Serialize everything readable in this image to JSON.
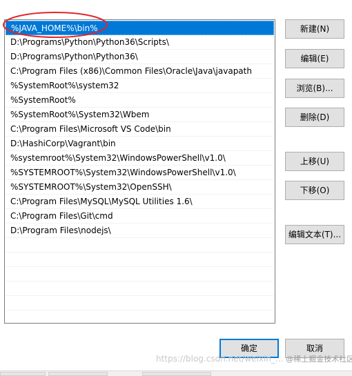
{
  "path_list": {
    "entries": [
      "%JAVA_HOME%\\bin%",
      "D:\\Programs\\Python\\Python36\\Scripts\\",
      "D:\\Programs\\Python\\Python36\\",
      "C:\\Program Files (x86)\\Common Files\\Oracle\\Java\\javapath",
      "%SystemRoot%\\system32",
      "%SystemRoot%",
      "%SystemRoot%\\System32\\Wbem",
      "C:\\Program Files\\Microsoft VS Code\\bin",
      "D:\\HashiCorp\\Vagrant\\bin",
      "%systemroot%\\System32\\WindowsPowerShell\\v1.0\\",
      "%SYSTEMROOT%\\System32\\WindowsPowerShell\\v1.0\\",
      "%SYSTEMROOT%\\System32\\OpenSSH\\",
      "C:\\Program Files\\MySQL\\MySQL Utilities 1.6\\",
      "C:\\Program Files\\Git\\cmd",
      "D:\\Program Files\\nodejs\\"
    ],
    "selected_index": 0
  },
  "buttons": {
    "new": "新建(N)",
    "edit": "编辑(E)",
    "browse": "浏览(B)...",
    "delete": "删除(D)",
    "move_up": "上移(U)",
    "move_down": "下移(O)",
    "edit_text": "编辑文本(T)...",
    "ok": "确定",
    "cancel": "取消"
  },
  "watermark": {
    "url": "https://blog.csdn.net/weixin_...",
    "community": "@稀土掘金技术社区"
  },
  "colors": {
    "selection": "#0078d7",
    "annotation": "#e0262b",
    "button_face": "#e1e1e1",
    "button_border": "#adadad"
  }
}
